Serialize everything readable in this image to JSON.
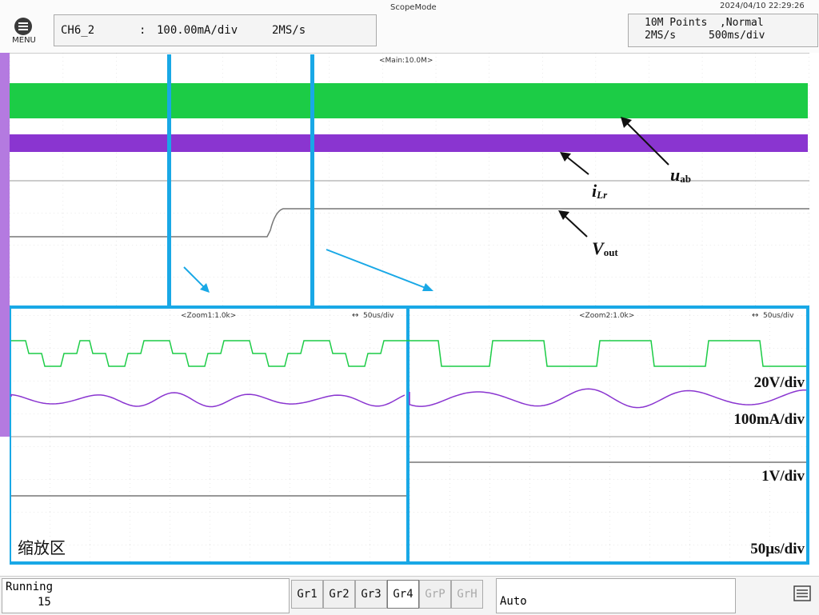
{
  "topbar": {
    "mode_title": "ScopeMode",
    "datetime": "2024/04/10 22:29:26",
    "menu_label": "MENU",
    "channel": {
      "name": "CH6_2",
      "separator": ":",
      "scale": "100.00mA/div",
      "rate": "2MS/s"
    },
    "acquisition": {
      "line1": "10M Points  ,Normal",
      "line2_rate": "2MS/s",
      "line2_timebase": "500ms/div"
    }
  },
  "main_plot": {
    "label": "<Main:10.0M>",
    "annotations": {
      "uab_main": "u",
      "uab_sub": "ab",
      "ilr_main": "i",
      "ilr_sub": "Lr",
      "vout_main": "V",
      "vout_sub": "out"
    }
  },
  "zoom1": {
    "label": "<Zoom1:1.0k>",
    "timebase": "50us/div",
    "arrow_glyph": "↔"
  },
  "zoom2": {
    "label": "<Zoom2:1.0k>",
    "timebase": "50us/div",
    "arrow_glyph": "↔"
  },
  "scales": {
    "voltage": "20V/div",
    "current": "100mA/div",
    "vout": "1V/div",
    "time": "50μs/div"
  },
  "zoom_area_label": "缩放区",
  "status": {
    "state": "Running",
    "count": "15",
    "groups": [
      "Gr1",
      "Gr2",
      "Gr3",
      "Gr4",
      "GrP",
      "GrH"
    ],
    "active_group": "Gr4",
    "trigger_mode": "Auto"
  },
  "colors": {
    "green": "#1ccc46",
    "purple": "#8a35d0",
    "gray_trace": "#777777",
    "cyan": "#19a8e6",
    "grid": "#cfcfcf"
  }
}
